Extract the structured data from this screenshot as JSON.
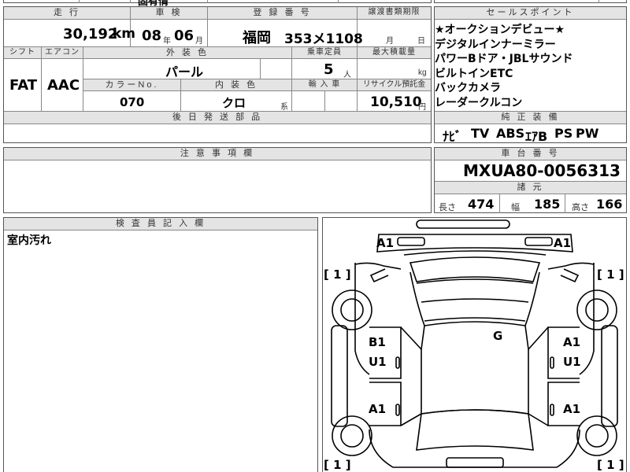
{
  "top_strip": {
    "partial_text": "固有情"
  },
  "mileage": {
    "header": "走 行",
    "value": "30,192",
    "unit": "km"
  },
  "inspection": {
    "header": "車 検",
    "year": "08",
    "year_unit": "年",
    "month": "06",
    "month_unit": "月"
  },
  "registration": {
    "header": "登 録 番 号",
    "region": "福岡",
    "number": "353メ1108"
  },
  "transfer_deadline": {
    "header": "譲渡書類期限",
    "month_unit": "月",
    "day_unit": "日"
  },
  "shift": {
    "header": "シフト",
    "value": "FAT"
  },
  "aircon": {
    "header": "エアコン",
    "value": "AAC"
  },
  "exterior_color": {
    "header": "外 装 色",
    "value": "パール"
  },
  "capacity": {
    "header": "乗車定員",
    "value": "5",
    "unit": "人"
  },
  "max_load": {
    "header": "最大積載量",
    "unit": "kg"
  },
  "color_no": {
    "header": "カラーNo.",
    "value": "070"
  },
  "interior_color": {
    "header": "内 装 色",
    "value": "クロ",
    "suffix": "系"
  },
  "import": {
    "header": "輸 入 車"
  },
  "recycle": {
    "header": "リサイクル預託金",
    "value": "10,510",
    "unit": "円"
  },
  "later_parts": {
    "header": "後 日 発 送 部 品"
  },
  "sales_points": {
    "header": "セールスポイント",
    "lines": [
      "★オークションデビュー★",
      "デジタルインナーミラー",
      "パワーBドア・JBLサウンド",
      "ビルトインETC",
      "バックカメラ",
      "レーダークルコン"
    ]
  },
  "equipment": {
    "header": "純 正 装 備",
    "items": [
      "ﾅﾋﾞ",
      "TV",
      "ABS",
      "ｴｱB",
      "PS",
      "PW"
    ]
  },
  "notes": {
    "header": "注 意 事 項 欄"
  },
  "chassis": {
    "header": "車 台 番 号",
    "value": "MXUA80-0056313"
  },
  "specs": {
    "header": "諸 元",
    "length_label": "長さ",
    "length": "474",
    "width_label": "幅",
    "width": "185",
    "height_label": "高さ",
    "height": "166"
  },
  "inspector": {
    "header": "検 査 員 記 入 欄",
    "remark": "室内汚れ"
  },
  "diagram": {
    "marks": {
      "front_left": "A1",
      "front_right": "A1",
      "left_front_wheel": "[ 1 ]",
      "right_front_wheel": "[ 1 ]",
      "left_front_door": "B1",
      "left_front_door_2": "U1",
      "roof": "G",
      "right_front_door": "A1",
      "right_front_door_2": "U1",
      "left_rear_door": "A1",
      "right_rear_door": "A1",
      "left_rear_wheel": "[ 1 ]",
      "right_rear_wheel": "[ 1 ]"
    }
  }
}
